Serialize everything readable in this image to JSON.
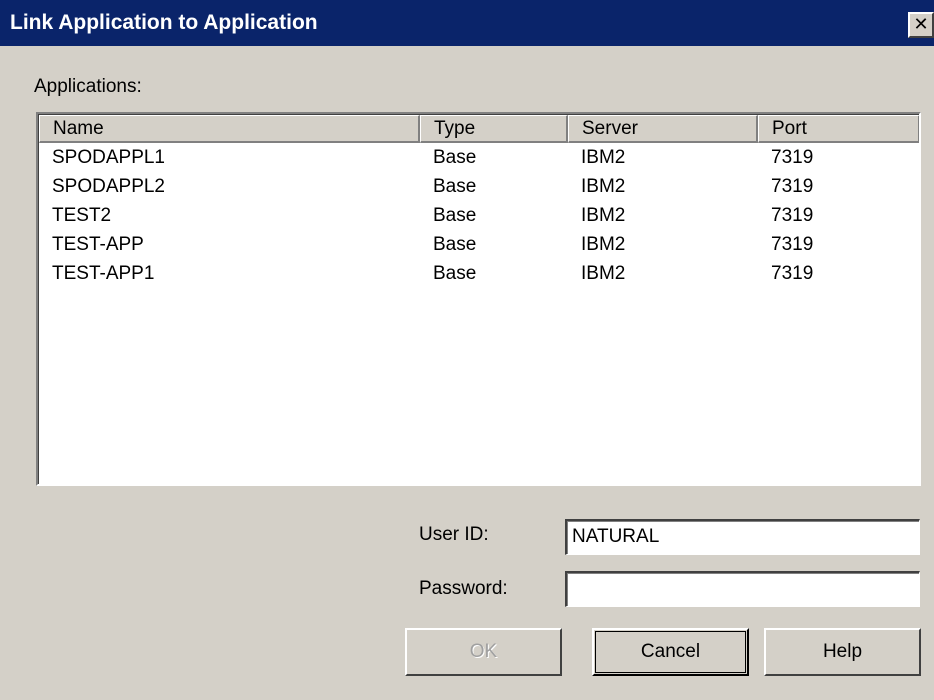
{
  "window": {
    "title": "Link Application to Application",
    "close_glyph": "✕"
  },
  "applications_label": "Applications:",
  "table": {
    "columns": [
      "Name",
      "Type",
      "Server",
      "Port"
    ],
    "rows": [
      [
        "SPODAPPL1",
        "Base",
        "IBM2",
        "7319"
      ],
      [
        "SPODAPPL2",
        "Base",
        "IBM2",
        "7319"
      ],
      [
        "TEST2",
        "Base",
        "IBM2",
        "7319"
      ],
      [
        "TEST-APP",
        "Base",
        "IBM2",
        "7319"
      ],
      [
        "TEST-APP1",
        "Base",
        "IBM2",
        "7319"
      ]
    ]
  },
  "form": {
    "user_id_label": "User ID:",
    "user_id_value": "NATURAL",
    "password_label": "Password:",
    "password_value": ""
  },
  "buttons": {
    "ok": "OK",
    "cancel": "Cancel",
    "help": "Help"
  },
  "colors": {
    "titlebar": "#0a246a",
    "face": "#d4d0c8"
  },
  "icons": {
    "close": "close-icon"
  }
}
